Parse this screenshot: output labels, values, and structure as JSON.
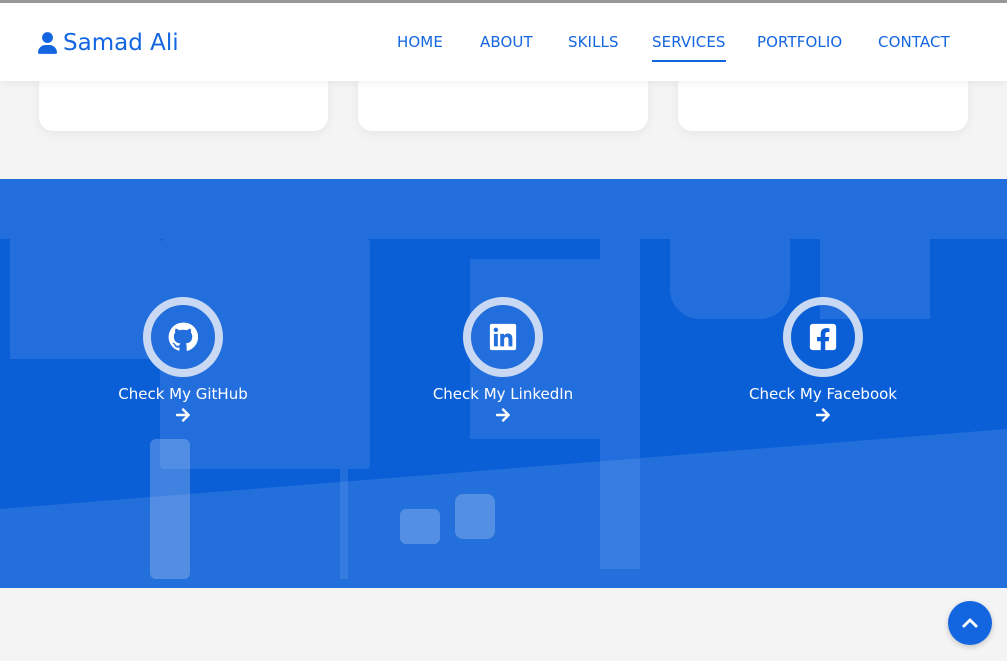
{
  "brand": {
    "name": "Samad Ali",
    "icon": "user-icon"
  },
  "nav": {
    "items": [
      {
        "label": "HOME"
      },
      {
        "label": "ABOUT"
      },
      {
        "label": "SKILLS"
      },
      {
        "label": "SERVICES",
        "active": true
      },
      {
        "label": "PORTFOLIO"
      },
      {
        "label": "CONTACT"
      }
    ]
  },
  "social": [
    {
      "label": "Check My GitHub",
      "icon": "github-icon"
    },
    {
      "label": "Check My LinkedIn",
      "icon": "linkedin-icon"
    },
    {
      "label": "Check My Facebook",
      "icon": "facebook-icon"
    }
  ],
  "colors": {
    "accent": "#1466e0",
    "band": "#0a5fd6",
    "ring": "#c9d9f3",
    "background": "#f4f4f4"
  }
}
